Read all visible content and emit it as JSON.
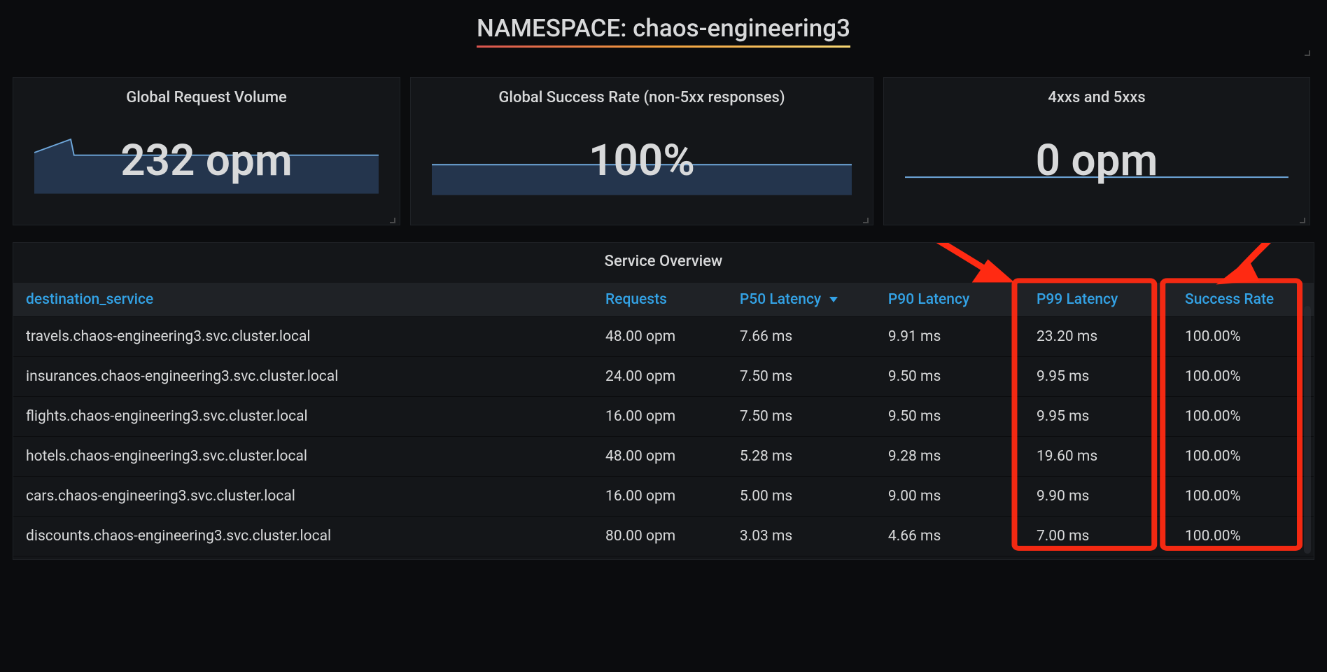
{
  "title": "NAMESPACE: chaos-engineering3",
  "stats": {
    "volume": {
      "label": "Global Request Volume",
      "value": "232 opm"
    },
    "success": {
      "label": "Global Success Rate (non-5xx responses)",
      "value": "100%"
    },
    "errors": {
      "label": "4xxs and 5xxs",
      "value": "0 opm"
    }
  },
  "table": {
    "title": "Service Overview",
    "columns": {
      "dest": "destination_service",
      "req": "Requests",
      "p50": "P50 Latency",
      "p90": "P90 Latency",
      "p99": "P99 Latency",
      "sr": "Success Rate"
    },
    "sorted_column": "p50",
    "rows": [
      {
        "dest": "travels.chaos-engineering3.svc.cluster.local",
        "req": "48.00 opm",
        "p50": "7.66 ms",
        "p90": "9.91 ms",
        "p99": "23.20 ms",
        "sr": "100.00%"
      },
      {
        "dest": "insurances.chaos-engineering3.svc.cluster.local",
        "req": "24.00 opm",
        "p50": "7.50 ms",
        "p90": "9.50 ms",
        "p99": "9.95 ms",
        "sr": "100.00%"
      },
      {
        "dest": "flights.chaos-engineering3.svc.cluster.local",
        "req": "16.00 opm",
        "p50": "7.50 ms",
        "p90": "9.50 ms",
        "p99": "9.95 ms",
        "sr": "100.00%"
      },
      {
        "dest": "hotels.chaos-engineering3.svc.cluster.local",
        "req": "48.00 opm",
        "p50": "5.28 ms",
        "p90": "9.28 ms",
        "p99": "19.60 ms",
        "sr": "100.00%"
      },
      {
        "dest": "cars.chaos-engineering3.svc.cluster.local",
        "req": "16.00 opm",
        "p50": "5.00 ms",
        "p90": "9.00 ms",
        "p99": "9.90 ms",
        "sr": "100.00%"
      },
      {
        "dest": "discounts.chaos-engineering3.svc.cluster.local",
        "req": "80.00 opm",
        "p50": "3.03 ms",
        "p90": "4.66 ms",
        "p99": "7.00 ms",
        "sr": "100.00%"
      }
    ]
  },
  "annotation_color": "#ff2a12"
}
